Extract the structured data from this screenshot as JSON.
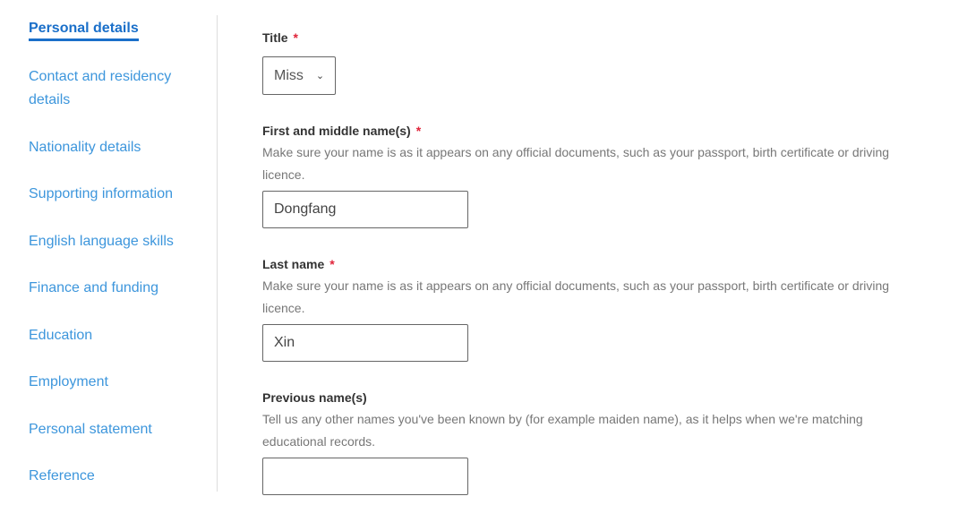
{
  "sidebar": {
    "items": [
      {
        "label": "Personal details",
        "active": true
      },
      {
        "label": "Contact and residency details"
      },
      {
        "label": "Nationality details"
      },
      {
        "label": "Supporting information"
      },
      {
        "label": "English language skills"
      },
      {
        "label": "Finance and funding"
      },
      {
        "label": "Education"
      },
      {
        "label": "Employment"
      },
      {
        "label": "Personal statement"
      },
      {
        "label": "Reference"
      }
    ]
  },
  "form": {
    "title": {
      "label": "Title",
      "required": "*",
      "value": "Miss"
    },
    "first": {
      "label": "First and middle name(s)",
      "required": "*",
      "hint": "Make sure your name is as it appears on any official documents, such as your passport, birth certificate or driving licence.",
      "value": "Dongfang"
    },
    "last": {
      "label": "Last name",
      "required": "*",
      "hint": "Make sure your name is as it appears on any official documents, such as your passport, birth certificate or driving licence.",
      "value": "Xin"
    },
    "previous": {
      "label": "Previous name(s)",
      "hint": "Tell us any other names you've been known by (for example maiden name), as it helps when we're matching educational records.",
      "value": ""
    }
  },
  "colors": {
    "active": "#1a6fc9",
    "link": "#3d96dc",
    "required": "#e0243a"
  }
}
